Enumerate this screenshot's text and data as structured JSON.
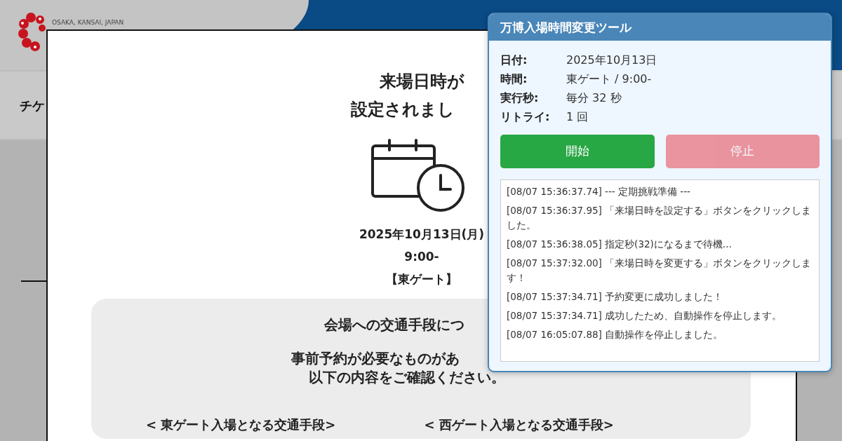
{
  "background_page": {
    "logo_caption": "OSAKA, KANSAI, JAPAN",
    "nav_text": "チケ"
  },
  "modal": {
    "title_lines": [
      "来場日時が",
      "設定されまし"
    ],
    "date": "2025年10月13日(月)",
    "time": "9:00-",
    "gate": "【東ゲート】",
    "transport": {
      "heading": "会場への交通手段につ",
      "notice_lines": [
        "事前予約が必要なものがあ",
        "以下の内容をご確認ください。"
      ],
      "columns": [
        "< 東ゲート入場となる交通手段>",
        "< 西ゲート入場となる交通手段>"
      ]
    }
  },
  "tool_panel": {
    "title": "万博入場時間変更ツール",
    "fields": [
      {
        "label": "日付:",
        "value": "2025年10月13日"
      },
      {
        "label": "時間:",
        "value": "東ゲート / 9:00-"
      },
      {
        "label": "実行秒:",
        "value": "毎分 32 秒"
      },
      {
        "label": "リトライ:",
        "value": "1 回"
      }
    ],
    "buttons": [
      {
        "label": "開始",
        "kind": "start",
        "disabled": false
      },
      {
        "label": "停止",
        "kind": "stop",
        "disabled": true
      }
    ],
    "log": [
      "[08/07 15:36:37.74] --- 定期挑戦準備 ---",
      "[08/07 15:36:37.95] 「来場日時を設定する」ボタンをクリックしました。",
      "[08/07 15:36:38.05] 指定秒(32)になるまで待機...",
      "[08/07 15:37:32.00] 「来場日時を変更する」ボタンをクリックします！",
      "[08/07 15:37:34.71] 予約変更に成功しました！",
      "[08/07 15:37:34.71] 成功したため、自動操作を停止します。",
      "[08/07 16:05:07.88] 自動操作を停止しました。"
    ]
  }
}
